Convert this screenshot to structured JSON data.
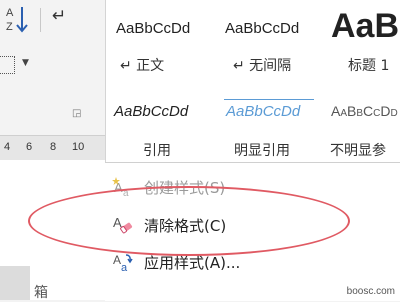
{
  "ruler": {
    "numbers": [
      "4",
      "6",
      "8",
      "10"
    ]
  },
  "styles_gallery": {
    "row1": [
      {
        "sample": "AaBbCcDd",
        "name": "↵ 正文"
      },
      {
        "sample": "AaBbCcDd",
        "name": "↵ 无间隔"
      },
      {
        "sample": "AaB",
        "name": "标题 1"
      }
    ],
    "row2": [
      {
        "sample": "AaBbCcDd",
        "name": "引用"
      },
      {
        "sample": "AaBbCcDd",
        "name": "明显引用"
      },
      {
        "sample": "AaBbCcDd",
        "name": "不明显参"
      }
    ]
  },
  "menu": {
    "items": [
      {
        "label": "创建样式(S)",
        "icon": "create-style-icon",
        "enabled": false
      },
      {
        "label": "清除格式(C)",
        "icon": "eraser-icon",
        "enabled": true
      },
      {
        "label": "应用样式(A)...",
        "icon": "apply-style-icon",
        "enabled": true
      }
    ]
  },
  "annotation": {
    "color": "#e05a63"
  },
  "watermark": "boosc.com"
}
